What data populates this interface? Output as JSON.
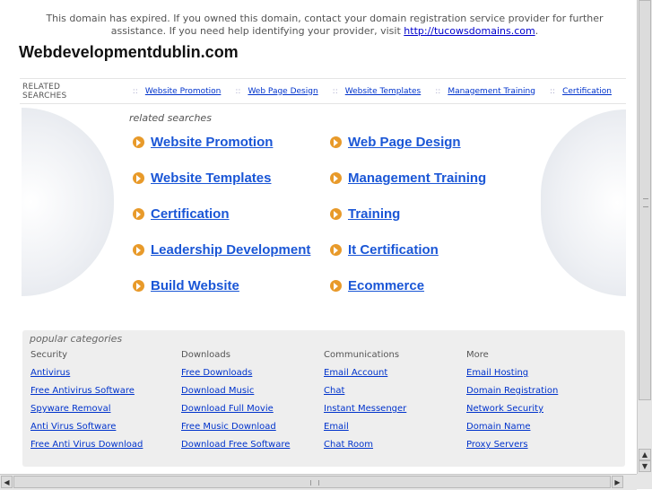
{
  "notice": {
    "text": "This domain has expired. If you owned this domain, contact your domain registration service provider for further assistance. If you need help identifying your provider, visit",
    "link": "http://tucowsdomains.com",
    "suffix": "."
  },
  "domain_title": "Webdevelopmentdublin.com",
  "related_bar": {
    "label": "RELATED SEARCHES",
    "separator": "::",
    "items": [
      "Website Promotion",
      "Web Page Design",
      "Website Templates",
      "Management Training",
      "Certification"
    ]
  },
  "related_searches": {
    "heading": "related searches",
    "items": [
      "Website Promotion",
      "Web Page Design",
      "Website Templates",
      "Management Training",
      "Certification",
      "Training",
      "Leadership Development",
      "It Certification",
      "Build Website",
      "Ecommerce"
    ]
  },
  "popular": {
    "heading": "popular categories",
    "columns": [
      {
        "title": "Security",
        "links": [
          "Antivirus",
          "Free Antivirus Software",
          "Spyware Removal",
          "Anti Virus Software",
          "Free Anti Virus Download"
        ]
      },
      {
        "title": "Downloads",
        "links": [
          "Free Downloads",
          "Download Music",
          "Download Full Movie",
          "Free Music Download",
          "Download Free Software"
        ]
      },
      {
        "title": "Communications",
        "links": [
          "Email Account",
          "Chat",
          "Instant Messenger",
          "Email",
          "Chat Room"
        ]
      },
      {
        "title": "More",
        "links": [
          "Email Hosting",
          "Domain Registration",
          "Network Security",
          "Domain Name",
          "Proxy Servers"
        ]
      }
    ]
  },
  "icons": {
    "arrow": "orange-circle-arrow-icon",
    "scroll_up": "▲",
    "scroll_down": "▼",
    "scroll_left": "◀",
    "scroll_right": "▶"
  },
  "colors": {
    "arrow": "#e89a2a",
    "link": "#1a56d6"
  }
}
